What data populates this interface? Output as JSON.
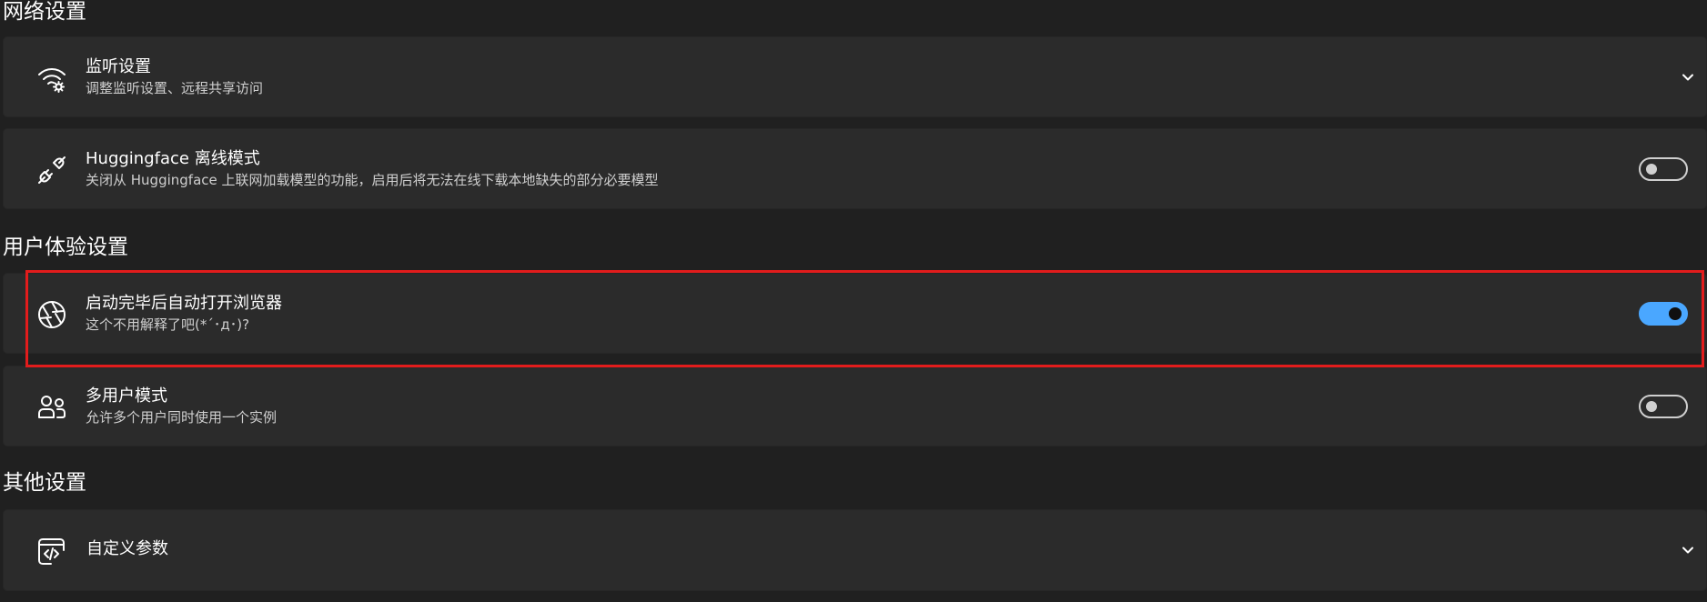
{
  "sections": {
    "network": {
      "title": "网络设置",
      "listen": {
        "title": "监听设置",
        "desc": "调整监听设置、远程共享访问",
        "icon": "wifi-gear-icon"
      },
      "hf_offline": {
        "title": "Huggingface 离线模式",
        "desc": "关闭从 Huggingface 上联网加载模型的功能，启用后将无法在线下载本地缺失的部分必要模型",
        "icon": "plug-disconnected-icon",
        "enabled": false
      }
    },
    "ux": {
      "title": "用户体验设置",
      "auto_browser": {
        "title": "启动完毕后自动打开浏览器",
        "desc": "这个不用解释了吧(*´･д･)?",
        "icon": "aperture-icon",
        "enabled": true
      },
      "multi_user": {
        "title": "多用户模式",
        "desc": "允许多个用户同时使用一个实例",
        "icon": "people-icon",
        "enabled": false
      }
    },
    "other": {
      "title": "其他设置",
      "custom_args": {
        "title": "自定义参数",
        "icon": "code-window-icon"
      }
    }
  },
  "colors": {
    "background": "#202020",
    "card": "#2b2b2b",
    "accent": "#4aa7ff",
    "highlight": "#e21c1c"
  }
}
